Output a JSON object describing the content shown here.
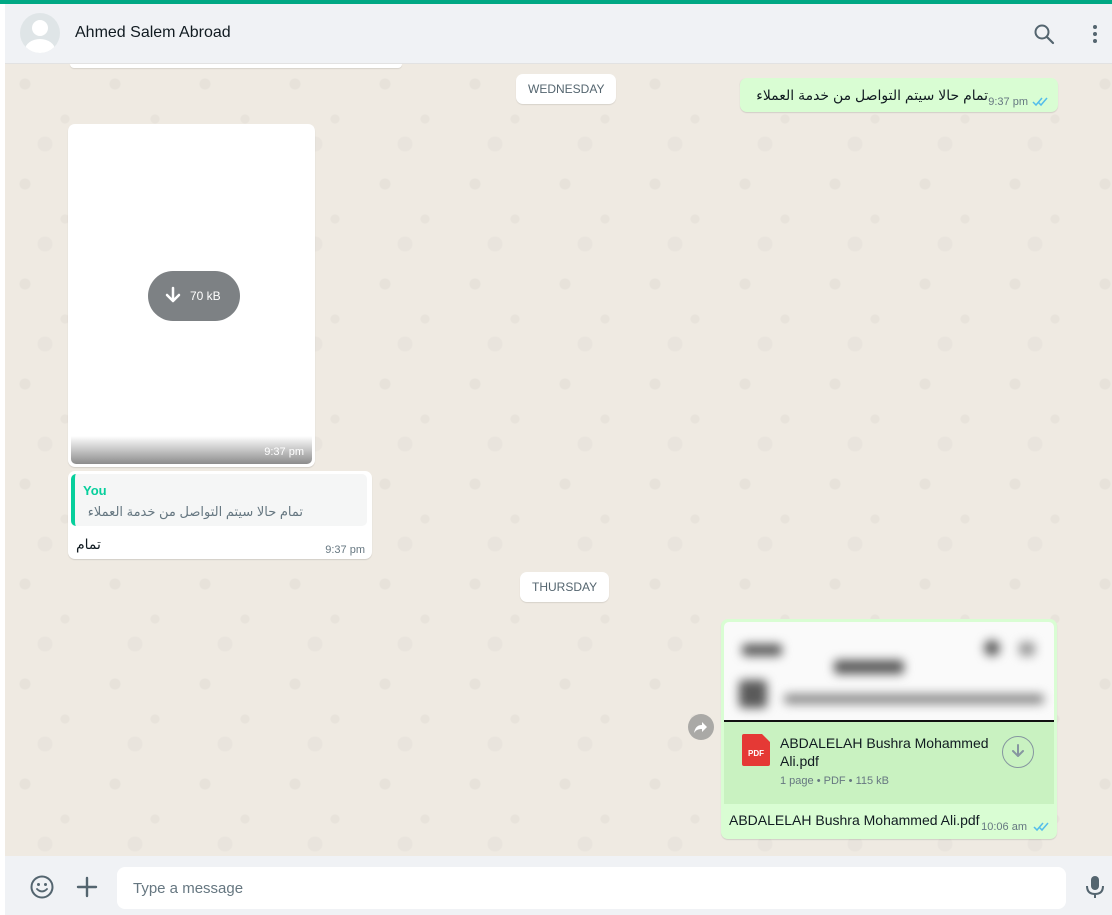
{
  "header": {
    "contact_name": "Ahmed Salem Abroad",
    "avatar_icon": "default-avatar-icon",
    "search_icon": "search-icon",
    "menu_icon": "more-vertical-icon"
  },
  "dates": {
    "wednesday": "WEDNESDAY",
    "thursday": "THURSDAY"
  },
  "messages": {
    "outgoing_1": {
      "text": "تمام حالا سيتم التواصل من خدمة العملاء",
      "time": "9:37 pm",
      "status": "read"
    },
    "incoming_image": {
      "download_size": "70 kB",
      "time": "9:37 pm"
    },
    "incoming_reply": {
      "quoted_author": "You",
      "quoted_text": "تمام حالا سيتم التواصل من خدمة العملاء",
      "text": "تمام",
      "time": "9:37 pm"
    },
    "outgoing_pdf": {
      "file_name": "ABDALELAH Bushra Mohammed Ali.pdf",
      "meta": "1 page • PDF • 115 kB",
      "icon_label": "PDF",
      "caption": "ABDALELAH Bushra Mohammed Ali.pdf",
      "time": "10:06 am",
      "status": "read"
    }
  },
  "composer": {
    "placeholder": "Type a message",
    "value": ""
  },
  "colors": {
    "accent": "#00a884",
    "outgoing_bubble": "#d9fdd3",
    "incoming_bubble": "#ffffff",
    "read_ticks": "#53bdeb",
    "pdf_red": "#e53935"
  }
}
